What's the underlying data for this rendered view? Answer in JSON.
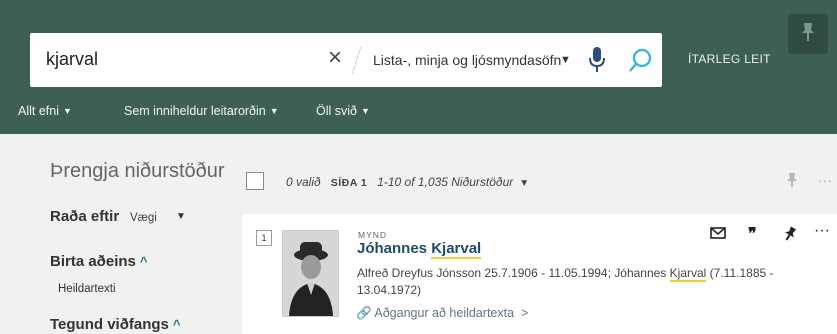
{
  "search": {
    "query": "kjarval",
    "scope": "Lista-, minja og ljósmyndasöfn",
    "advanced_label": "ÍTARLEG LEIT"
  },
  "filters": [
    {
      "label": "Allt efni"
    },
    {
      "label": "Sem inniheldur leitarorðin"
    },
    {
      "label": "Öll svið"
    }
  ],
  "sidebar": {
    "title": "Þrengja niðurstöður",
    "sort_label": "Raða eftir",
    "sort_value": "Vægi",
    "show_only_label": "Birta aðeins",
    "show_only_items": [
      "Heildartexti"
    ],
    "resource_type_label": "Tegund viðfangs"
  },
  "toolbar": {
    "selected": "0 valið",
    "page_label": "SÍÐA 1",
    "range": "1-10 of 1,035 Niðurstöður"
  },
  "results": [
    {
      "index": "1",
      "type": "MYND",
      "title_prefix": "Jóhannes ",
      "title_highlight": "Kjarval",
      "desc_part1": "Alfreð Dreyfus Jónsson 25.7.1906 - 11.05.1994; Jóhannes ",
      "desc_highlight": "Kjarval",
      "desc_part2": " (7.11.1885 - 13.04.1972)",
      "access": "Aðgangur að heildartexta"
    }
  ],
  "colors": {
    "header_bg": "#3e5f55",
    "link": "#1d4d6b",
    "highlight": "#f6cf2a",
    "search_icon": "#3fb6e6"
  }
}
